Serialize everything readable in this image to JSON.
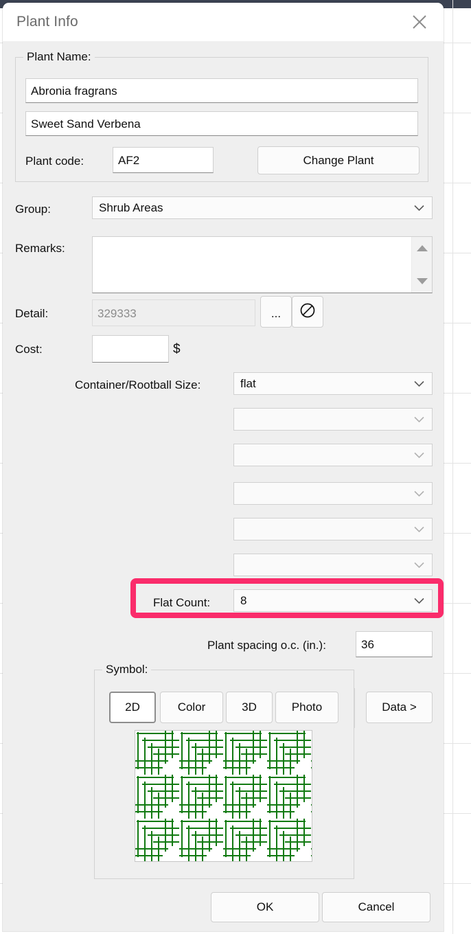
{
  "window": {
    "title": "Plant Info",
    "close_icon": "close-icon"
  },
  "plant_name_group": {
    "legend": "Plant Name:",
    "botanical_name": "Abronia fragrans",
    "common_name": "Sweet Sand Verbena",
    "plant_code_label": "Plant code:",
    "plant_code_value": "AF2",
    "change_plant_label": "Change Plant"
  },
  "group_row": {
    "label": "Group:",
    "value": "Shrub Areas"
  },
  "remarks_row": {
    "label": "Remarks:",
    "value": "",
    "scroll_up_icon": "triangle-up-icon",
    "scroll_down_icon": "triangle-down-icon"
  },
  "detail_row": {
    "label": "Detail:",
    "value": "329333",
    "browse_label": "...",
    "clear_icon": "prohibited-icon"
  },
  "cost_row": {
    "label": "Cost:",
    "value": "",
    "currency": "$"
  },
  "size_rows": {
    "container_label": "Container/Rootball Size:",
    "container_value": "flat",
    "empty_values": [
      "",
      "",
      "",
      "",
      ""
    ]
  },
  "flat_count_row": {
    "label": "Flat Count:",
    "value": "8",
    "highlight_color": "#FA2C6B",
    "highlighted": true
  },
  "spacing_row": {
    "label": "Plant spacing o.c. (in.):",
    "value": "36"
  },
  "symbol_group": {
    "legend": "Symbol:",
    "tabs": [
      {
        "label": "2D",
        "selected": true
      },
      {
        "label": "Color",
        "selected": false
      },
      {
        "label": "3D",
        "selected": false
      },
      {
        "label": "Photo",
        "selected": false
      }
    ],
    "data_button_label": "Data >",
    "preview": {
      "pattern": "herringbone-parquet",
      "line_color": "#127a12",
      "background": "#ffffff"
    }
  },
  "footer": {
    "ok_label": "OK",
    "cancel_label": "Cancel"
  }
}
